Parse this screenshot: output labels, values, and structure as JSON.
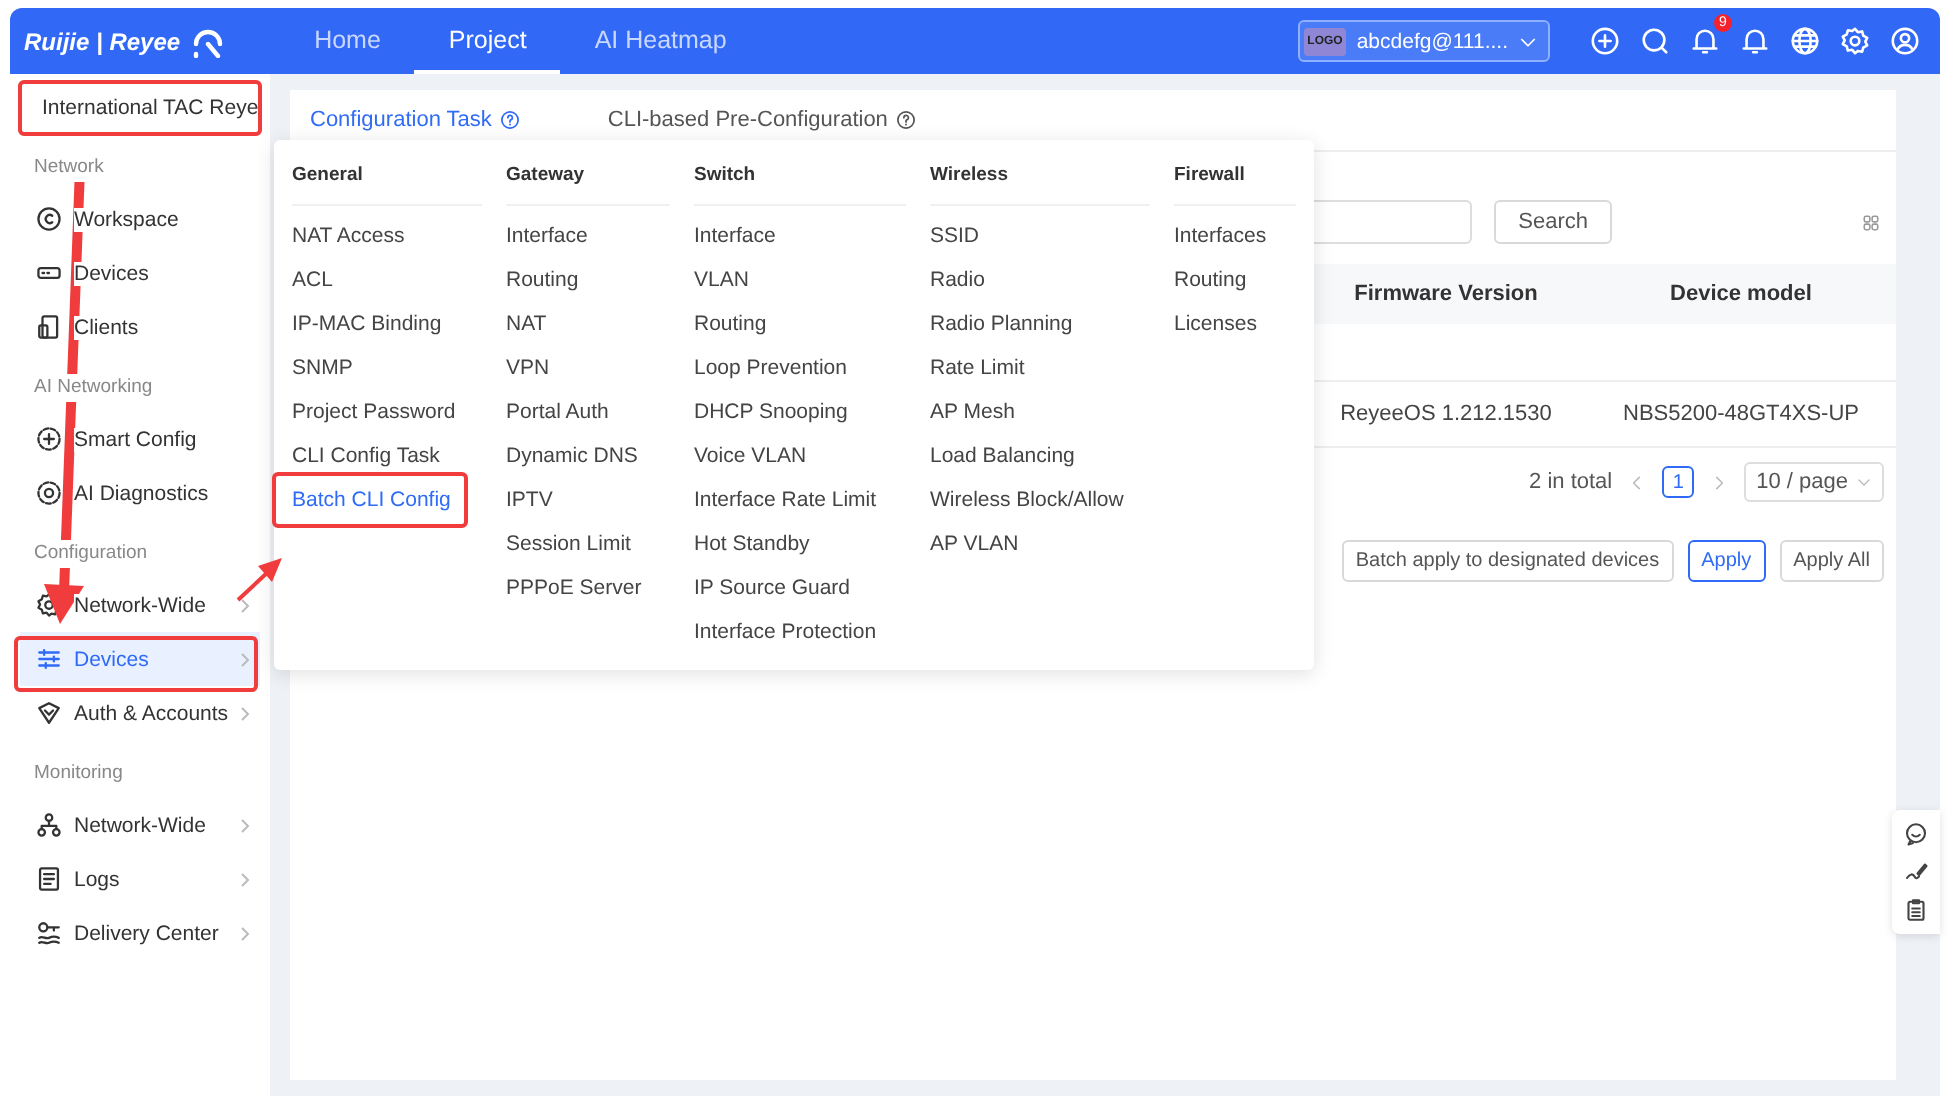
{
  "header": {
    "logo": "Ruijie | Reyee",
    "nav": [
      {
        "label": "Home",
        "selected": false
      },
      {
        "label": "Project",
        "selected": true
      },
      {
        "label": "AI Heatmap",
        "selected": false
      }
    ],
    "account": {
      "logo": "LOGO",
      "name": "abcdefg@111...."
    },
    "notification_count": "9"
  },
  "sidebar": {
    "project": "International TAC Reye",
    "sections": [
      {
        "title": "Network",
        "items": [
          {
            "label": "Workspace",
            "selected": false,
            "has_submenu": false
          },
          {
            "label": "Devices",
            "selected": false,
            "has_submenu": false
          },
          {
            "label": "Clients",
            "selected": false,
            "has_submenu": false
          }
        ]
      },
      {
        "title": "AI Networking",
        "items": [
          {
            "label": "Smart Config",
            "selected": false,
            "has_submenu": false
          },
          {
            "label": "AI Diagnostics",
            "selected": false,
            "has_submenu": false
          }
        ]
      },
      {
        "title": "Configuration",
        "items": [
          {
            "label": "Network-Wide",
            "selected": false,
            "has_submenu": true
          },
          {
            "label": "Devices",
            "selected": true,
            "has_submenu": true
          },
          {
            "label": "Auth & Accounts",
            "selected": false,
            "has_submenu": true
          }
        ]
      },
      {
        "title": "Monitoring",
        "items": [
          {
            "label": "Network-Wide",
            "selected": false,
            "has_submenu": true
          },
          {
            "label": "Logs",
            "selected": false,
            "has_submenu": true
          },
          {
            "label": "Delivery Center",
            "selected": false,
            "has_submenu": true
          }
        ]
      }
    ]
  },
  "tabs": [
    {
      "label": "Configuration Task",
      "selected": true
    },
    {
      "label": "CLI-based Pre-Configuration",
      "selected": false
    }
  ],
  "search_button": "Search",
  "table": {
    "columns": [
      "Firmware Version",
      "Device model"
    ],
    "rows": [
      [
        "ReyeeOS 1.212.1530",
        "NBS5200-48GT4XS-UP"
      ]
    ]
  },
  "pagination": {
    "total": "2 in total",
    "pages": [
      {
        "label": "1",
        "selected": true
      }
    ],
    "page_size": "10 / page"
  },
  "actions": [
    {
      "label": "Batch apply to designated devices",
      "primary": false
    },
    {
      "label": "Apply",
      "primary": true
    },
    {
      "label": "Apply All",
      "primary": false
    }
  ],
  "menu": {
    "columns": [
      {
        "title": "General",
        "items": [
          {
            "label": "NAT Access",
            "selected": false
          },
          {
            "label": "ACL",
            "selected": false
          },
          {
            "label": "IP-MAC Binding",
            "selected": false
          },
          {
            "label": "SNMP",
            "selected": false
          },
          {
            "label": "Project Password",
            "selected": false
          },
          {
            "label": "CLI Config Task",
            "selected": false
          },
          {
            "label": "Batch CLI Config",
            "selected": true
          }
        ]
      },
      {
        "title": "Gateway",
        "items": [
          {
            "label": "Interface",
            "selected": false
          },
          {
            "label": "Routing",
            "selected": false
          },
          {
            "label": "NAT",
            "selected": false
          },
          {
            "label": "VPN",
            "selected": false
          },
          {
            "label": "Portal Auth",
            "selected": false
          },
          {
            "label": "Dynamic DNS",
            "selected": false
          },
          {
            "label": "IPTV",
            "selected": false
          },
          {
            "label": "Session Limit",
            "selected": false
          },
          {
            "label": "PPPoE Server",
            "selected": false
          }
        ]
      },
      {
        "title": "Switch",
        "items": [
          {
            "label": "Interface",
            "selected": false
          },
          {
            "label": "VLAN",
            "selected": false
          },
          {
            "label": "Routing",
            "selected": false
          },
          {
            "label": "Loop Prevention",
            "selected": false
          },
          {
            "label": "DHCP Snooping",
            "selected": false
          },
          {
            "label": "Voice VLAN",
            "selected": false
          },
          {
            "label": "Interface Rate Limit",
            "selected": false
          },
          {
            "label": "Hot Standby",
            "selected": false
          },
          {
            "label": "IP Source Guard",
            "selected": false
          },
          {
            "label": "Interface Protection",
            "selected": false
          }
        ]
      },
      {
        "title": "Wireless",
        "items": [
          {
            "label": "SSID",
            "selected": false
          },
          {
            "label": "Radio",
            "selected": false
          },
          {
            "label": "Radio Planning",
            "selected": false
          },
          {
            "label": "Rate Limit",
            "selected": false
          },
          {
            "label": "AP Mesh",
            "selected": false
          },
          {
            "label": "Load Balancing",
            "selected": false
          },
          {
            "label": "Wireless Block/Allow",
            "selected": false
          },
          {
            "label": "AP VLAN",
            "selected": false
          }
        ]
      },
      {
        "title": "Firewall",
        "items": [
          {
            "label": "Interfaces",
            "selected": false
          },
          {
            "label": "Routing",
            "selected": false
          },
          {
            "label": "Licenses",
            "selected": false
          }
        ]
      }
    ]
  }
}
